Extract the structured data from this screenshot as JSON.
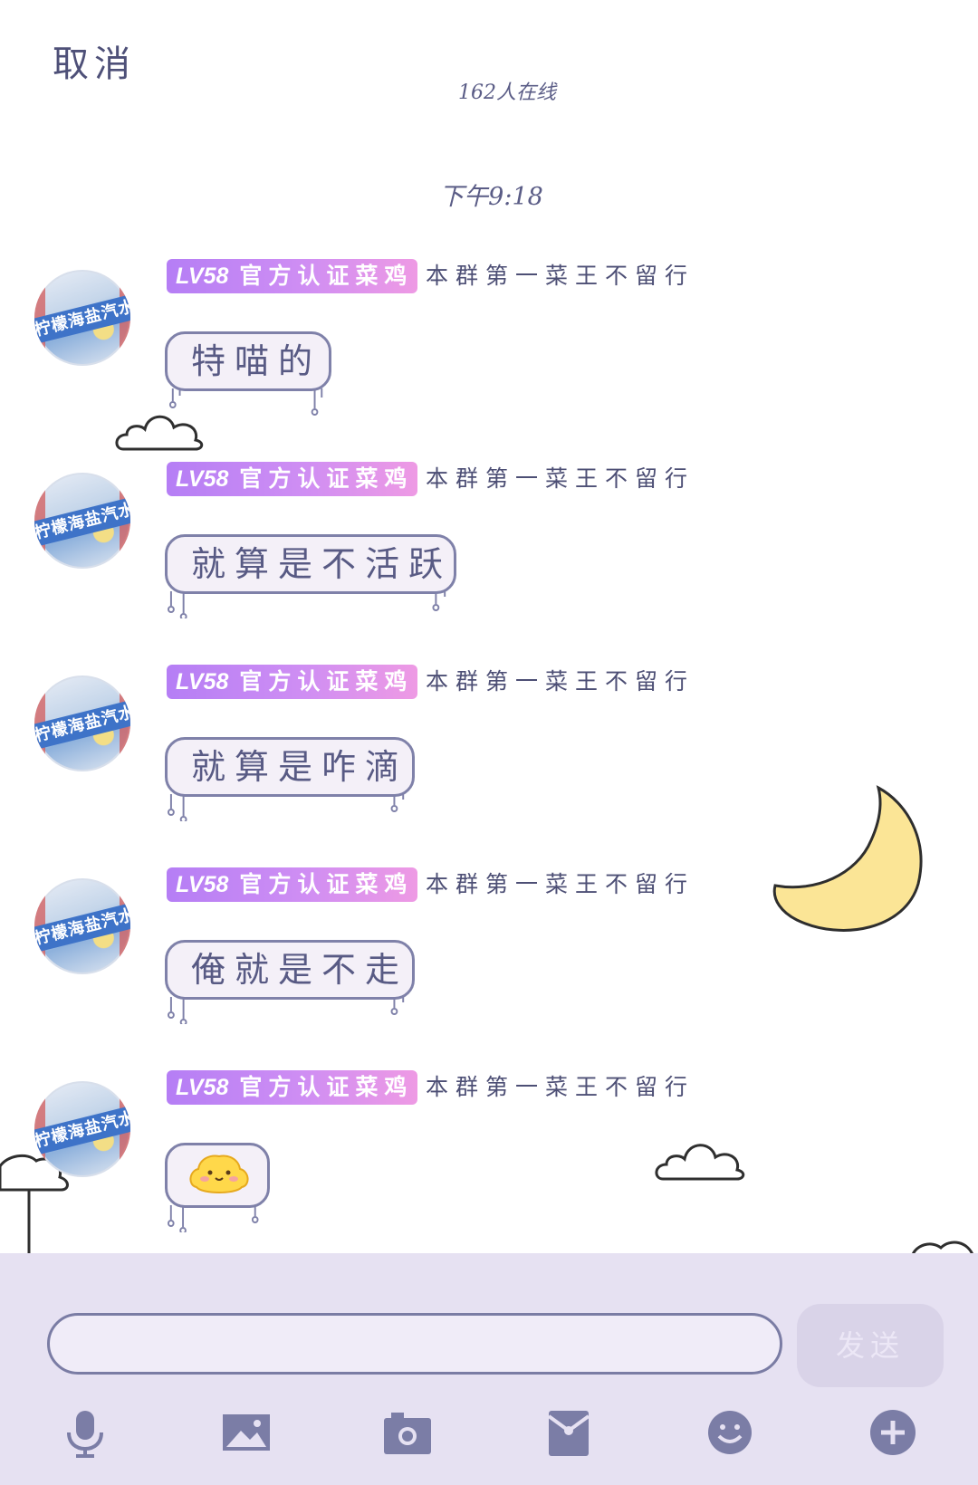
{
  "header": {
    "cancel_label": "取消",
    "online_count": "162人在线"
  },
  "timestamp": "下午9:18",
  "sender": {
    "level": "LV58",
    "badge_title": "官方认证菜鸡",
    "nickname": "本群第一菜王不留行",
    "avatar_text": "柠檬海盐汽水"
  },
  "messages": [
    {
      "type": "text",
      "text": "特喵的"
    },
    {
      "type": "text",
      "text": "就算是不活跃"
    },
    {
      "type": "text",
      "text": "就算是咋滴"
    },
    {
      "type": "text",
      "text": "俺就是不走"
    },
    {
      "type": "sticker",
      "icon": "yellow-chick-emoji-icon"
    }
  ],
  "compose": {
    "input_value": "",
    "send_label": "发送"
  },
  "toolbar": [
    "microphone-icon",
    "image-icon",
    "camera-icon",
    "red-packet-icon",
    "emoji-icon",
    "plus-icon"
  ],
  "colors": {
    "text": "#5a5c86",
    "badge_start": "#b57ef5",
    "badge_end": "#ee9ae4",
    "bubble_fill": "#f4f0f8",
    "bubble_border": "#7f81a9",
    "compose_bg": "#e6e1f2",
    "moon": "#fbe596"
  }
}
